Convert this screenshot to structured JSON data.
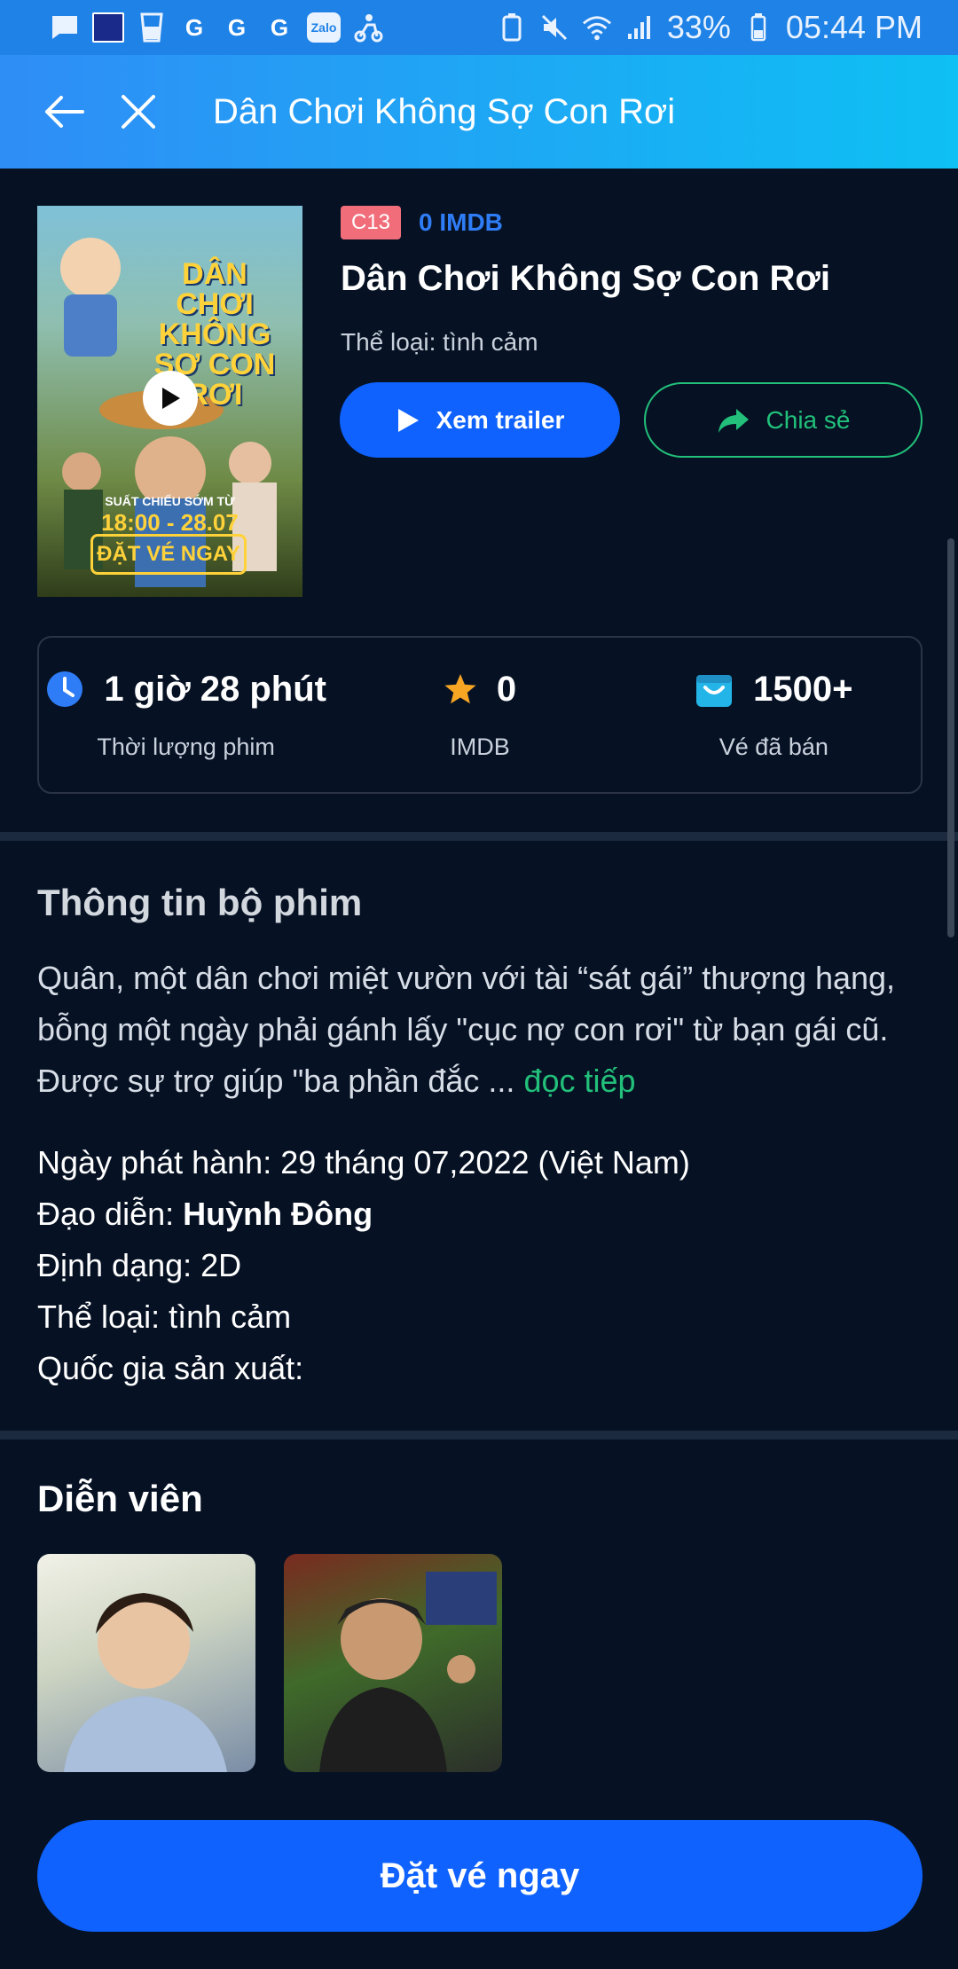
{
  "status_bar": {
    "battery": "33%",
    "time": "05:44 PM",
    "left_icons": [
      "chat-icon",
      "flag-icon",
      "cup-icon",
      "g-icon",
      "g-icon",
      "g-icon",
      "zalo-icon",
      "scooter-icon"
    ],
    "right_icons": [
      "battery-saver-icon",
      "mute-icon",
      "wifi-icon",
      "signal-icon",
      "battery-icon"
    ]
  },
  "header": {
    "title": "Dân Chơi Không Sợ Con Rơi"
  },
  "poster": {
    "title_text": "DÂN CHƠI KHÔNG SỢ CON RƠI",
    "showtime_label": "SUẤT CHIẾU SỚM TỪ",
    "showtime_value": "18:00 - 28.07",
    "cta_text": "ĐẶT VÉ NGAY"
  },
  "movie": {
    "age_badge": "C13",
    "imdb_top": "0 IMDB",
    "title": "Dân Chơi Không Sợ Con Rơi",
    "genre_line": "Thể loại: tình cảm",
    "trailer_label": "Xem trailer",
    "share_label": "Chia sẻ"
  },
  "stats": [
    {
      "value": "1 giờ 28 phút",
      "label": "Thời lượng phim",
      "icon": "clock-icon"
    },
    {
      "value": "0",
      "label": "IMDB",
      "icon": "star-icon"
    },
    {
      "value": "1500+",
      "label": "Vé đã bán",
      "icon": "ticket-bag-icon"
    }
  ],
  "info_section": {
    "title": "Thông tin bộ phim",
    "synopsis": "Quân, một dân chơi miệt vườn với tài “sát gái” thượng hạng, bỗng một ngày phải gánh lấy \"cục nợ con rơi\" từ bạn gái cũ. Được sự trợ giúp \"ba phần đắc ...",
    "read_more": "đọc tiếp",
    "release_label": "Ngày phát hành:",
    "release_value": "29 tháng 07,2022 (Việt Nam)",
    "director_label": "Đạo diễn:",
    "director_value": "Huỳnh Đông",
    "format_label": "Định dạng:",
    "format_value": "2D",
    "genre_label": "Thể loại:",
    "genre_value": "tình cảm",
    "country_label": "Quốc gia sản xuất:",
    "country_value": ""
  },
  "cast_section": {
    "title": "Diễn viên"
  },
  "book_button": "Đặt vé ngay",
  "colors": {
    "background": "#061224",
    "primary": "#0f62fe",
    "accent_green": "#22c07a",
    "badge": "#f16d7a"
  }
}
